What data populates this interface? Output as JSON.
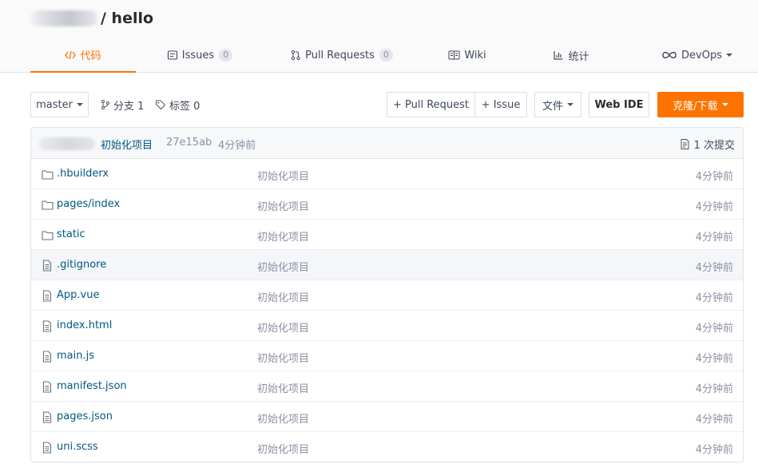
{
  "repo": {
    "separator": "/ hello"
  },
  "tabs": [
    {
      "label": "代码",
      "icon": "code-icon",
      "active": true
    },
    {
      "label": "Issues",
      "badge": "0",
      "icon": "issues-icon"
    },
    {
      "label": "Pull Requests",
      "badge": "0",
      "icon": "pull-request-icon"
    },
    {
      "label": "Wiki",
      "icon": "wiki-icon"
    },
    {
      "label": "统计",
      "icon": "stats-icon"
    },
    {
      "label": "DevOps",
      "icon": "devops-icon"
    }
  ],
  "toolbar": {
    "branch": "master",
    "branches_label": "分支 1",
    "tags_label": "标签 0",
    "new_pr": "+ Pull Request",
    "new_issue": "+ Issue",
    "file_menu": "文件",
    "web_ide": "Web IDE",
    "clone_download": "克隆/下载"
  },
  "commit": {
    "message": "初始化项目",
    "hash": "27e15ab",
    "time": "4分钟前",
    "count_label": "1 次提交"
  },
  "files": [
    {
      "name": ".hbuilderx",
      "type": "folder",
      "message": "初始化项目",
      "time": "4分钟前"
    },
    {
      "name": "pages/index",
      "type": "folder",
      "message": "初始化项目",
      "time": "4分钟前"
    },
    {
      "name": "static",
      "type": "folder",
      "message": "初始化项目",
      "time": "4分钟前"
    },
    {
      "name": ".gitignore",
      "type": "file",
      "message": "初始化项目",
      "time": "4分钟前"
    },
    {
      "name": "App.vue",
      "type": "file",
      "message": "初始化项目",
      "time": "4分钟前"
    },
    {
      "name": "index.html",
      "type": "file",
      "message": "初始化项目",
      "time": "4分钟前"
    },
    {
      "name": "main.js",
      "type": "file",
      "message": "初始化项目",
      "time": "4分钟前"
    },
    {
      "name": "manifest.json",
      "type": "file",
      "message": "初始化项目",
      "time": "4分钟前"
    },
    {
      "name": "pages.json",
      "type": "file",
      "message": "初始化项目",
      "time": "4分钟前"
    },
    {
      "name": "uni.scss",
      "type": "file",
      "message": "初始化项目",
      "time": "4分钟前"
    }
  ],
  "colors": {
    "accent": "#fe7300",
    "link": "#005980",
    "muted": "#8c92a4"
  }
}
